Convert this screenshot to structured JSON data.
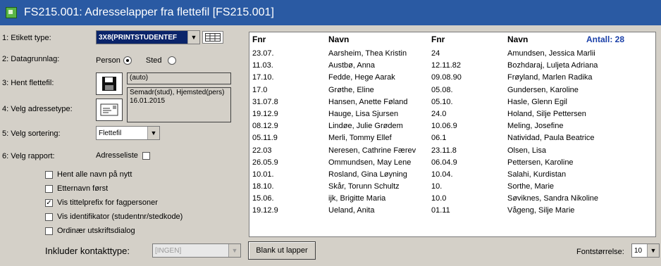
{
  "window": {
    "title": "FS215.001: Adresselapper fra flettefil [FS215.001]"
  },
  "form": {
    "etikett_label": "1: Etikett type:",
    "etikett_value": "3X8(PRINTSTUDENTEF",
    "datagrunnlag_label": "2: Datagrunnlag:",
    "person_label": "Person",
    "sted_label": "Sted",
    "hent_label": "3: Hent flettefil:",
    "hent_value": "(auto)",
    "adressetype_label": "4: Velg adressetype:",
    "adressetype_value": "Semadr(stud), Hjemsted(pers) 16.01.2015",
    "sortering_label": "5: Velg sortering:",
    "sortering_value": "Flettefil",
    "rapport_label": "6: Velg rapport:",
    "rapport_value": "Adresseliste"
  },
  "options": [
    {
      "label": "Hent alle navn på nytt",
      "checked": false
    },
    {
      "label": "Etternavn først",
      "checked": false
    },
    {
      "label": "Vis tittelprefix for fagpersoner",
      "checked": true
    },
    {
      "label": "Vis identifikator (studentnr/stedkode)",
      "checked": false
    },
    {
      "label": "Ordinær utskriftsdialog",
      "checked": false
    }
  ],
  "bottom": {
    "kontakt_label": "Inkluder kontakttype:",
    "kontakt_value": "[INGEN]",
    "blank_button": "Blank ut lapper",
    "font_label": "Fontstørrelse:",
    "font_value": "10"
  },
  "list": {
    "headers": {
      "fnr1": "Fnr",
      "navn1": "Navn",
      "fnr2": "Fnr",
      "navn2": "Navn",
      "antall": "Antall: 28"
    },
    "fnr1": [
      "23.07.",
      "11.03.",
      "17.10.",
      "17.0",
      "31.07.8",
      "19.12.9",
      "08.12.9",
      "05.11.9",
      "22.03",
      "26.05.9",
      "10.01.",
      "18.10.",
      "15.06.",
      "19.12.9"
    ],
    "navn1": [
      "Aarsheim, Thea Kristin",
      "Austbø, Anna",
      "Fedde, Hege Aarak",
      "Grøthe, Eline",
      "Hansen, Anette Føland",
      "Hauge, Lisa Sjursen",
      "Lindøe, Julie Grødem",
      "Merli, Tommy Ellef",
      "Neresen, Cathrine Færev",
      "Ommundsen, May Lene",
      "Rosland, Gina Løyning",
      "Skår, Torunn Schultz",
      "ijk, Brigitte Maria",
      "Ueland, Anita"
    ],
    "fnr2": [
      "24",
      "12.11.82",
      "09.08.90",
      "05.08.",
      "05.10.",
      "24.0",
      "10.06.9",
      "06.1",
      "23.11.8",
      "06.04.9",
      "10.04.",
      "10.",
      "10.0",
      "01.11"
    ],
    "navn2": [
      "Amundsen, Jessica Marlii",
      "Bozhdaraj, Luljeta Adriana",
      "Frøyland, Marlen Radika",
      "Gundersen, Karoline",
      "Hasle, Glenn Egil",
      "Holand, Silje Pettersen",
      "Meling, Josefine",
      "Natividad, Paula Beatrice",
      "Olsen, Lisa",
      "Pettersen, Karoline",
      "Salahi, Kurdistan",
      "Sorthe, Marie",
      "Søviknes, Sandra Nikoline",
      "Vågeng, Silje Marie"
    ]
  }
}
